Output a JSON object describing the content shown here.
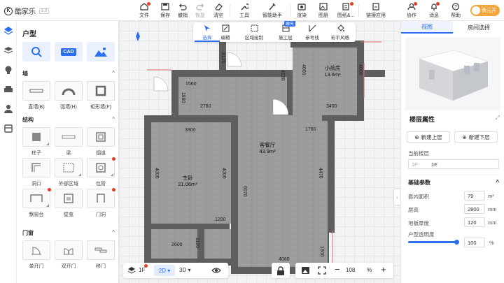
{
  "app": {
    "name": "酷家乐",
    "version": "5.0"
  },
  "toolbar": {
    "file": "文件",
    "save": "保存",
    "undo": "撤销",
    "redo": "恢复",
    "clear": "清空",
    "tools": "工具",
    "assistant": "智能助手",
    "render": "渲染",
    "drawing": "图册",
    "images": "图纸&...",
    "link_apps": "链接应用",
    "collab": "协作",
    "messages": "消息",
    "help": "帮助",
    "account": "黄元开"
  },
  "left_panel": {
    "title": "户型",
    "top_cards": [
      "search-card",
      "CAD",
      "image-card"
    ],
    "cad_label": "CAD",
    "sections": {
      "wall": {
        "title": "墙",
        "items": [
          "直墙(B)",
          "弧墙(H)",
          "矩形墙(F)"
        ]
      },
      "structure": {
        "title": "结构",
        "items": [
          "柱子",
          "梁",
          "烟道",
          "洞口",
          "外部区域",
          "包管",
          "飘窗台",
          "壁龛",
          "门洞"
        ]
      },
      "doors": {
        "title": "门窗",
        "items": [
          "单开门",
          "双开门",
          "移门"
        ]
      }
    },
    "chevron": "^"
  },
  "canvas_toolbar": {
    "items": [
      "选择",
      "编辑",
      "区域绘制",
      "施工层",
      "参考线",
      "彩平风格"
    ],
    "new_badge": "跟失"
  },
  "floorplan": {
    "rooms": [
      {
        "name": "小孩房",
        "area": "13.6m²"
      },
      {
        "name": "客餐厅",
        "area": "43.9m²"
      },
      {
        "name": "主卧",
        "area": "21.06m²"
      }
    ],
    "dimensions": [
      "2120",
      "4120",
      "1560",
      "1880",
      "2760",
      "4000",
      "4000",
      "3400",
      "3800",
      "1760",
      "4000",
      "4000",
      "4470",
      "6070",
      "1200",
      "2600",
      "1120",
      "4080",
      "1600"
    ]
  },
  "bottom_bar": {
    "floor": "1F",
    "view_2d": "2D",
    "view_3d": "3D",
    "zoom": "108",
    "zoom_unit": "%",
    "minus": "−",
    "plus": "+"
  },
  "right_panel": {
    "tabs": [
      "视图",
      "房间选择"
    ],
    "floor_props_title": "楼层属性",
    "new_upper": "新建上层",
    "new_lower": "新建下层",
    "current_floor_label": "当前楼层",
    "current_floor_prefix": "1F",
    "current_floor_value": "1F",
    "basic_params": "基础参数",
    "inner_area_label": "套内面积",
    "inner_area_value": "79",
    "inner_area_unit": "m²",
    "height_label": "层高",
    "height_value": "2800",
    "height_unit": "mm",
    "slab_label": "地板厚度",
    "slab_value": "120",
    "slab_unit": "mm",
    "opacity_label": "户型透明度",
    "opacity_value": "100",
    "opacity_unit": "%"
  },
  "colors": {
    "accent": "#2b6ff4",
    "wall": "#5a5a5a",
    "floor": "#9a9a9a",
    "badge": "#e0402c"
  }
}
